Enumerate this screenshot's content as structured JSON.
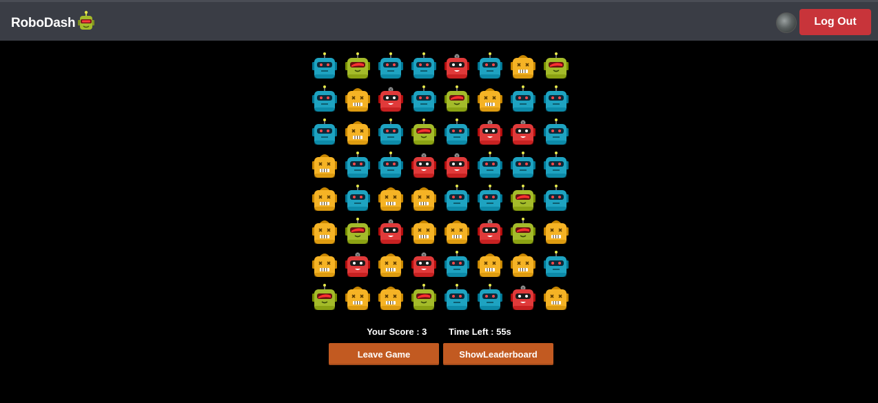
{
  "app": {
    "brand": "RoboDash",
    "logout_label": "Log Out"
  },
  "colors": {
    "red": "#e03a3a",
    "yellow": "#f5b325",
    "blue": "#1ea3c1",
    "green": "#a4bb2a",
    "navbar": "#3a3d45",
    "logout": "#c8343a",
    "action": "#c25a21"
  },
  "board": {
    "rows": [
      [
        "blue",
        "green",
        "blue",
        "blue",
        "red",
        "blue",
        "yellow",
        "green"
      ],
      [
        "blue",
        "yellow",
        "red",
        "blue",
        "green",
        "yellow",
        "blue",
        "blue"
      ],
      [
        "blue",
        "yellow",
        "blue",
        "green",
        "blue",
        "red",
        "red",
        "blue"
      ],
      [
        "yellow",
        "blue",
        "blue",
        "red",
        "red",
        "blue",
        "blue",
        "blue"
      ],
      [
        "yellow",
        "blue",
        "yellow",
        "yellow",
        "blue",
        "blue",
        "green",
        "blue"
      ],
      [
        "yellow",
        "green",
        "red",
        "yellow",
        "yellow",
        "red",
        "green",
        "yellow"
      ],
      [
        "yellow",
        "red",
        "yellow",
        "red",
        "blue",
        "yellow",
        "yellow",
        "blue"
      ],
      [
        "green",
        "yellow",
        "yellow",
        "green",
        "blue",
        "blue",
        "red",
        "yellow"
      ]
    ]
  },
  "status": {
    "score_label": "Your Score : 3",
    "time_label": "Time Left : 55s"
  },
  "actions": {
    "leave_label": "Leave Game",
    "leaderboard_label": "ShowLeaderboard"
  }
}
